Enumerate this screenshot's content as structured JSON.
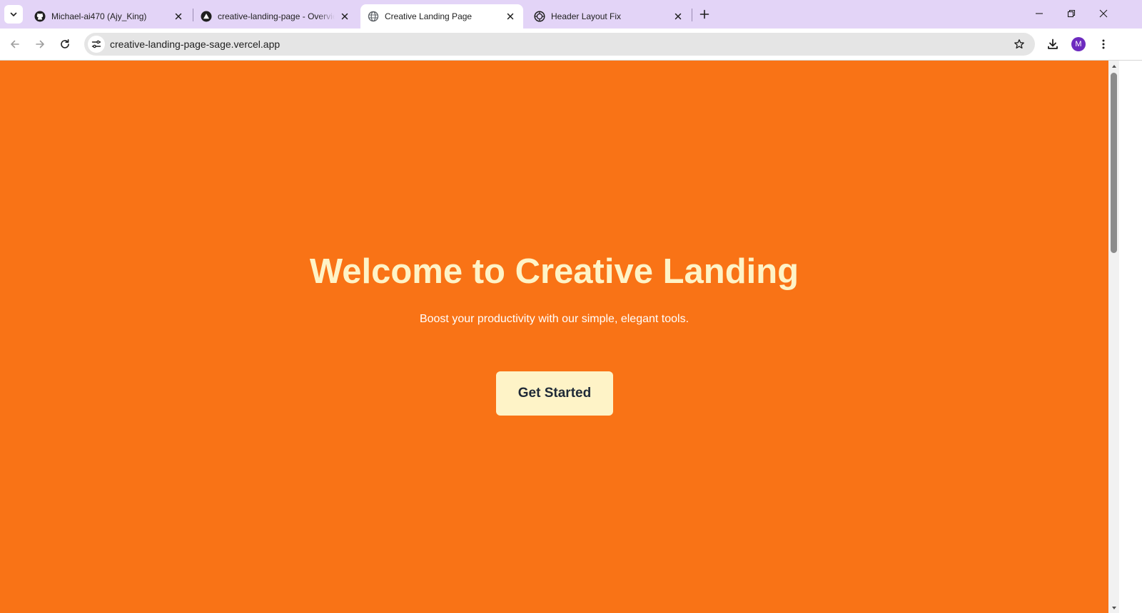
{
  "browser": {
    "tabs": [
      {
        "title": "Michael-ai470 (Ajy_King)",
        "icon": "github-icon",
        "active": false
      },
      {
        "title": "creative-landing-page - Overview",
        "icon": "vercel-icon",
        "active": false
      },
      {
        "title": "Creative Landing Page",
        "icon": "globe-icon",
        "active": true
      },
      {
        "title": "Header Layout Fix",
        "icon": "chatgpt-icon",
        "active": false
      }
    ],
    "address_bar": {
      "url": "creative-landing-page-sage.vercel.app"
    },
    "profile_initial": "M",
    "colors": {
      "tabstrip": "#e3d4f7",
      "omnibox": "#e5e5e5",
      "avatar": "#6d2bbf"
    }
  },
  "page": {
    "hero": {
      "title": "Welcome to Creative Landing",
      "subtitle": "Boost your productivity with our simple, elegant tools.",
      "cta_label": "Get Started"
    },
    "colors": {
      "background": "#f97316",
      "title": "#fef3c7",
      "subtitle": "#ffffff",
      "cta_background": "#fef3c7",
      "cta_text": "#1f2937"
    }
  }
}
